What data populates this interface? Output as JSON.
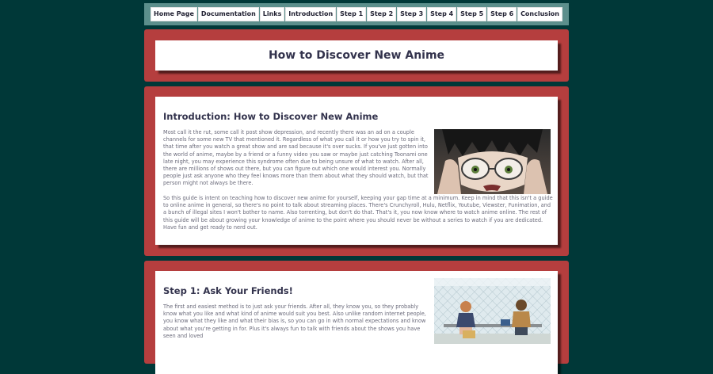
{
  "nav": {
    "items": [
      "Home Page",
      "Documentation",
      "Links",
      "Introduction",
      "Step 1",
      "Step 2",
      "Step 3",
      "Step 4",
      "Step 5",
      "Step 6",
      "Conclusion"
    ]
  },
  "header": {
    "title": "How to Discover New Anime"
  },
  "intro": {
    "title": "Introduction: How to Discover New Anime",
    "p1": "Most call it the rut, some call it post show depression, and recently there was an ad on a couple channels for some new TV that mentioned it. Regardless of what you call it or how you try to spin it, that time after you watch a great show and are sad because it's over sucks. If you've just gotten into the world of anime, maybe by a friend or a funny video you saw or maybe just catching Toonami one late night, you may experience this syndrome often due to being unsure of what to watch. After all, there are millions of shows out there, but you can figure out which one would interest you. Normally people just ask anyone who they feel knows more than them about what they should watch, but that person might not always be there.",
    "p2": "So this guide is intent on teaching how to discover new anime for yourself, keeping your gap time at a minimum. Keep in mind that this isn't a guide to online anime in general, so there's no point to talk about streaming places. There's Crunchyroll, Hulu, Netflix, Youtube, Viewster, Funimation, and a bunch of illegal sites I won't bother to name. Also torrenting, but don't do that. That's it, you now know where to watch anime online. The rest of this guide will be about growing your knowledge of anime to the point where you should never be without a series to watch if you are dedicated. Have fun and get ready to nerd out."
  },
  "step1": {
    "title": "Step 1: Ask Your Friends!",
    "p1": "The first and easiest method is to just ask your friends. After all, they know you, so they probably know what you like and what kind of anime would suit you best. Also unlike random internet people, you know what they like and what their bias is, so you can go in with normal expectations and know about what you're getting in for. Plus it's always fun to talk with friends about the shows you have seen and loved"
  },
  "colors": {
    "background": "#003838",
    "nav": "#5c8f8c",
    "panel": "#b53e3e",
    "title": "#33334d"
  }
}
